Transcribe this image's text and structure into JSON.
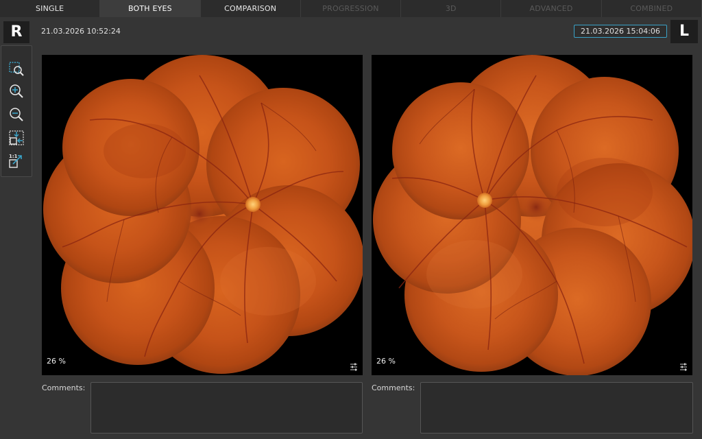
{
  "tabs": [
    {
      "label": "SINGLE",
      "state": "normal"
    },
    {
      "label": "BOTH EYES",
      "state": "active"
    },
    {
      "label": "COMPARISON",
      "state": "normal"
    },
    {
      "label": "PROGRESSION",
      "state": "disabled"
    },
    {
      "label": "3D",
      "state": "disabled"
    },
    {
      "label": "ADVANCED",
      "state": "disabled"
    },
    {
      "label": "COMBINED",
      "state": "disabled"
    }
  ],
  "right_eye": {
    "badge": "R",
    "timestamp": "21.03.2026 10:52:24",
    "zoom": "26 %",
    "comments_label": "Comments:",
    "comments_value": ""
  },
  "left_eye": {
    "badge": "L",
    "timestamp": "21.03.2026 15:04:06",
    "zoom": "26 %",
    "comments_label": "Comments:",
    "comments_value": ""
  },
  "tools": [
    {
      "icon": "zoom-region-icon"
    },
    {
      "icon": "zoom-in-icon"
    },
    {
      "icon": "zoom-out-icon"
    },
    {
      "icon": "fit-to-window-icon"
    },
    {
      "icon": "actual-size-icon"
    }
  ],
  "colors": {
    "accent": "#3aa3c8",
    "background": "#353535",
    "fundus": "#c4501c"
  }
}
